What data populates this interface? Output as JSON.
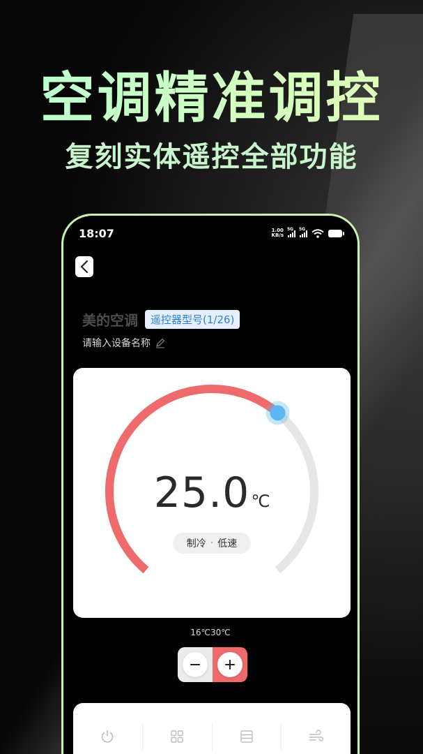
{
  "promo": {
    "headline": "空调精准调控",
    "subline": "复刻实体遥控全部功能"
  },
  "status_bar": {
    "time": "18:07",
    "net_speed_value": "1.00",
    "net_speed_unit": "KB/s",
    "sim1_label": "5G",
    "sim2_label": "5G"
  },
  "device": {
    "name": "美的空调",
    "model_badge": "遥控器型号(1/26)",
    "rename_placeholder": "请输入设备名称"
  },
  "thermostat": {
    "temperature": "25.0",
    "unit": "℃",
    "mode": "制冷",
    "separator": "·",
    "fan_speed": "低速",
    "min_label": "16℃",
    "max_label": "30℃",
    "min_value": 16,
    "max_value": 30,
    "current_value": 25.0
  },
  "colors": {
    "accent_red": "#ef6b6b",
    "knob_blue": "#5cb6ef",
    "track_gray": "#e6e6e6",
    "headline_green": "#c8f5cc",
    "phone_frame": "#c9f2ad"
  },
  "functions": [
    {
      "icon": "power-icon"
    },
    {
      "icon": "grid-icon"
    },
    {
      "icon": "list-icon"
    },
    {
      "icon": "wind-icon"
    }
  ]
}
